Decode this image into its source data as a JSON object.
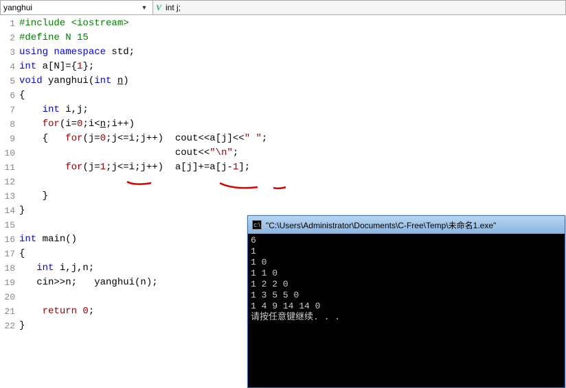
{
  "toolbar": {
    "scope": "yanghui",
    "member": "int j;"
  },
  "code": {
    "lines": [
      {
        "n": 1,
        "tokens": [
          {
            "t": "#include <iostream>",
            "c": "kw-green"
          }
        ]
      },
      {
        "n": 2,
        "tokens": [
          {
            "t": "#define N ",
            "c": "kw-green"
          },
          {
            "t": "15",
            "c": "kw-green"
          }
        ]
      },
      {
        "n": 3,
        "tokens": [
          {
            "t": "using namespace ",
            "c": "kw-blue"
          },
          {
            "t": "std",
            "c": ""
          },
          {
            "t": ";",
            "c": ""
          }
        ]
      },
      {
        "n": 4,
        "tokens": [
          {
            "t": "int ",
            "c": "kw-blue"
          },
          {
            "t": "a",
            "c": ""
          },
          {
            "t": "[",
            "c": ""
          },
          {
            "t": "N",
            "c": ""
          },
          {
            "t": "]",
            "c": ""
          },
          {
            "t": "=",
            "c": ""
          },
          {
            "t": "{",
            "c": ""
          },
          {
            "t": "1",
            "c": "num"
          },
          {
            "t": "}",
            "c": ""
          },
          {
            "t": ";",
            "c": ""
          }
        ]
      },
      {
        "n": 5,
        "tokens": [
          {
            "t": "void ",
            "c": "kw-blue"
          },
          {
            "t": "yanghui",
            "c": ""
          },
          {
            "t": "(",
            "c": ""
          },
          {
            "t": "int ",
            "c": "kw-blue"
          },
          {
            "t": "n",
            "c": "underline"
          },
          {
            "t": ")",
            "c": ""
          }
        ]
      },
      {
        "n": 6,
        "tokens": [
          {
            "t": "{",
            "c": ""
          }
        ]
      },
      {
        "n": 7,
        "tokens": [
          {
            "t": "    ",
            "c": ""
          },
          {
            "t": "int ",
            "c": "kw-blue"
          },
          {
            "t": "i,j;",
            "c": ""
          }
        ]
      },
      {
        "n": 8,
        "tokens": [
          {
            "t": "    ",
            "c": ""
          },
          {
            "t": "for",
            "c": "kw-red"
          },
          {
            "t": "(i=",
            "c": ""
          },
          {
            "t": "0",
            "c": "num"
          },
          {
            "t": ";i<",
            "c": ""
          },
          {
            "t": "n",
            "c": "underline"
          },
          {
            "t": ";i++)",
            "c": ""
          }
        ]
      },
      {
        "n": 9,
        "tokens": [
          {
            "t": "    {   ",
            "c": ""
          },
          {
            "t": "for",
            "c": "kw-red"
          },
          {
            "t": "(j=",
            "c": ""
          },
          {
            "t": "0",
            "c": "num"
          },
          {
            "t": ";j<=i;j++)  cout<<a[j]<<",
            "c": ""
          },
          {
            "t": "\" \"",
            "c": "str"
          },
          {
            "t": ";",
            "c": ""
          }
        ]
      },
      {
        "n": 10,
        "tokens": [
          {
            "t": "                           cout<<",
            "c": ""
          },
          {
            "t": "\"\\n\"",
            "c": "str"
          },
          {
            "t": ";",
            "c": ""
          }
        ]
      },
      {
        "n": 11,
        "tokens": [
          {
            "t": "        ",
            "c": ""
          },
          {
            "t": "for",
            "c": "kw-red"
          },
          {
            "t": "(j=",
            "c": ""
          },
          {
            "t": "1",
            "c": "num"
          },
          {
            "t": ";j<=i;j++)  a[j]+=a[j-",
            "c": ""
          },
          {
            "t": "1",
            "c": "num"
          },
          {
            "t": "];",
            "c": ""
          }
        ]
      },
      {
        "n": 12,
        "tokens": []
      },
      {
        "n": 13,
        "tokens": [
          {
            "t": "    }",
            "c": ""
          }
        ]
      },
      {
        "n": 14,
        "tokens": [
          {
            "t": "}",
            "c": ""
          }
        ]
      },
      {
        "n": 15,
        "tokens": []
      },
      {
        "n": 16,
        "tokens": [
          {
            "t": "int ",
            "c": "kw-blue"
          },
          {
            "t": "main",
            "c": ""
          },
          {
            "t": "()",
            "c": ""
          }
        ]
      },
      {
        "n": 17,
        "tokens": [
          {
            "t": "{",
            "c": ""
          }
        ]
      },
      {
        "n": 18,
        "tokens": [
          {
            "t": "   ",
            "c": ""
          },
          {
            "t": "int ",
            "c": "kw-blue"
          },
          {
            "t": "i,j,n;",
            "c": ""
          }
        ]
      },
      {
        "n": 19,
        "tokens": [
          {
            "t": "   cin>>n;   yanghui(n);",
            "c": ""
          }
        ]
      },
      {
        "n": 20,
        "tokens": []
      },
      {
        "n": 21,
        "tokens": [
          {
            "t": "    ",
            "c": ""
          },
          {
            "t": "return ",
            "c": "kw-red"
          },
          {
            "t": "0",
            "c": "num"
          },
          {
            "t": ";",
            "c": ""
          }
        ]
      },
      {
        "n": 22,
        "tokens": [
          {
            "t": "}",
            "c": ""
          }
        ]
      }
    ]
  },
  "console": {
    "title": "\"C:\\Users\\Administrator\\Documents\\C-Free\\Temp\\未命名1.exe\"",
    "output": "6\n1\n1 0\n1 1 0\n1 2 2 0\n1 3 5 5 0\n1 4 9 14 14 0\n请按任意键继续. . ."
  }
}
